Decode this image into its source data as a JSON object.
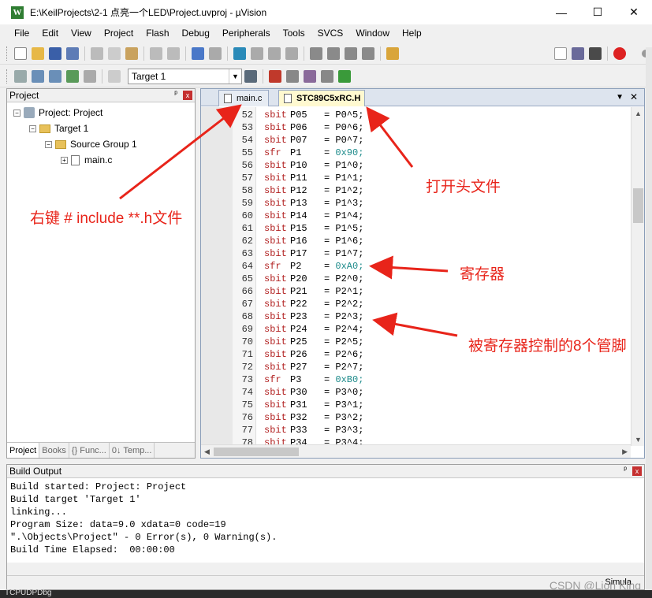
{
  "window": {
    "title": "E:\\KeilProjects\\2-1 点亮一个LED\\Project.uvproj - µVision",
    "icon_glyph": "W",
    "controls": {
      "minimize": "—",
      "maximize": "☐",
      "close": "✕"
    }
  },
  "menu": [
    "File",
    "Edit",
    "View",
    "Project",
    "Flash",
    "Debug",
    "Peripherals",
    "Tools",
    "SVCS",
    "Window",
    "Help"
  ],
  "toolbar2": {
    "target": "Target 1"
  },
  "project_panel": {
    "title": "Project",
    "pin": "ᵖ",
    "close": "x",
    "tree": {
      "root": "Project: Project",
      "target": "Target 1",
      "group": "Source Group 1",
      "file": "main.c"
    },
    "tabs": [
      "Project",
      "Books",
      "{} Func...",
      "0↓ Temp..."
    ]
  },
  "editor": {
    "tabs": [
      "main.c",
      "STC89C5xRC.H"
    ],
    "active_tab": "STC89C5xRC.H",
    "lines": [
      {
        "n": "52",
        "kw": "sbit",
        "name": "P05",
        "val": "P0^5;"
      },
      {
        "n": "53",
        "kw": "sbit",
        "name": "P06",
        "val": "P0^6;"
      },
      {
        "n": "54",
        "kw": "sbit",
        "name": "P07",
        "val": "P0^7;"
      },
      {
        "n": "55",
        "kw": "sfr",
        "name": "P1",
        "val": "0x90;"
      },
      {
        "n": "56",
        "kw": "sbit",
        "name": "P10",
        "val": "P1^0;"
      },
      {
        "n": "57",
        "kw": "sbit",
        "name": "P11",
        "val": "P1^1;"
      },
      {
        "n": "58",
        "kw": "sbit",
        "name": "P12",
        "val": "P1^2;"
      },
      {
        "n": "59",
        "kw": "sbit",
        "name": "P13",
        "val": "P1^3;"
      },
      {
        "n": "60",
        "kw": "sbit",
        "name": "P14",
        "val": "P1^4;"
      },
      {
        "n": "61",
        "kw": "sbit",
        "name": "P15",
        "val": "P1^5;"
      },
      {
        "n": "62",
        "kw": "sbit",
        "name": "P16",
        "val": "P1^6;"
      },
      {
        "n": "63",
        "kw": "sbit",
        "name": "P17",
        "val": "P1^7;"
      },
      {
        "n": "64",
        "kw": "sfr",
        "name": "P2",
        "val": "0xA0;"
      },
      {
        "n": "65",
        "kw": "sbit",
        "name": "P20",
        "val": "P2^0;"
      },
      {
        "n": "66",
        "kw": "sbit",
        "name": "P21",
        "val": "P2^1;"
      },
      {
        "n": "67",
        "kw": "sbit",
        "name": "P22",
        "val": "P2^2;"
      },
      {
        "n": "68",
        "kw": "sbit",
        "name": "P23",
        "val": "P2^3;"
      },
      {
        "n": "69",
        "kw": "sbit",
        "name": "P24",
        "val": "P2^4;"
      },
      {
        "n": "70",
        "kw": "sbit",
        "name": "P25",
        "val": "P2^5;"
      },
      {
        "n": "71",
        "kw": "sbit",
        "name": "P26",
        "val": "P2^6;"
      },
      {
        "n": "72",
        "kw": "sbit",
        "name": "P27",
        "val": "P2^7;"
      },
      {
        "n": "73",
        "kw": "sfr",
        "name": "P3",
        "val": "0xB0;"
      },
      {
        "n": "74",
        "kw": "sbit",
        "name": "P30",
        "val": "P3^0;"
      },
      {
        "n": "75",
        "kw": "sbit",
        "name": "P31",
        "val": "P3^1;"
      },
      {
        "n": "76",
        "kw": "sbit",
        "name": "P32",
        "val": "P3^2;"
      },
      {
        "n": "77",
        "kw": "sbit",
        "name": "P33",
        "val": "P3^3;"
      },
      {
        "n": "78",
        "kw": "sbit",
        "name": "P34",
        "val": "P3^4;"
      }
    ]
  },
  "build_output": {
    "title": "Build Output",
    "lines": [
      "Build started: Project: Project",
      "Build target 'Target 1'",
      "linking...",
      "Program Size: data=9.0 xdata=0 code=19",
      "\".\\Objects\\Project\" - 0 Error(s), 0 Warning(s).",
      "Build Time Elapsed:  00:00:00"
    ],
    "status": "Simula"
  },
  "annotations": {
    "include": "右键 # include **.h文件",
    "open_header": "打开头文件",
    "register": "寄存器",
    "pins": "被寄存器控制的8个管脚"
  },
  "watermark": "CSDN @Lion King",
  "taskbar_text": "TCPUDPDbg",
  "colors": {
    "annotation": "#e8241a",
    "keyword": "#b22222",
    "hex": "#1c8a8a",
    "active_tab": "#fff9d0"
  }
}
